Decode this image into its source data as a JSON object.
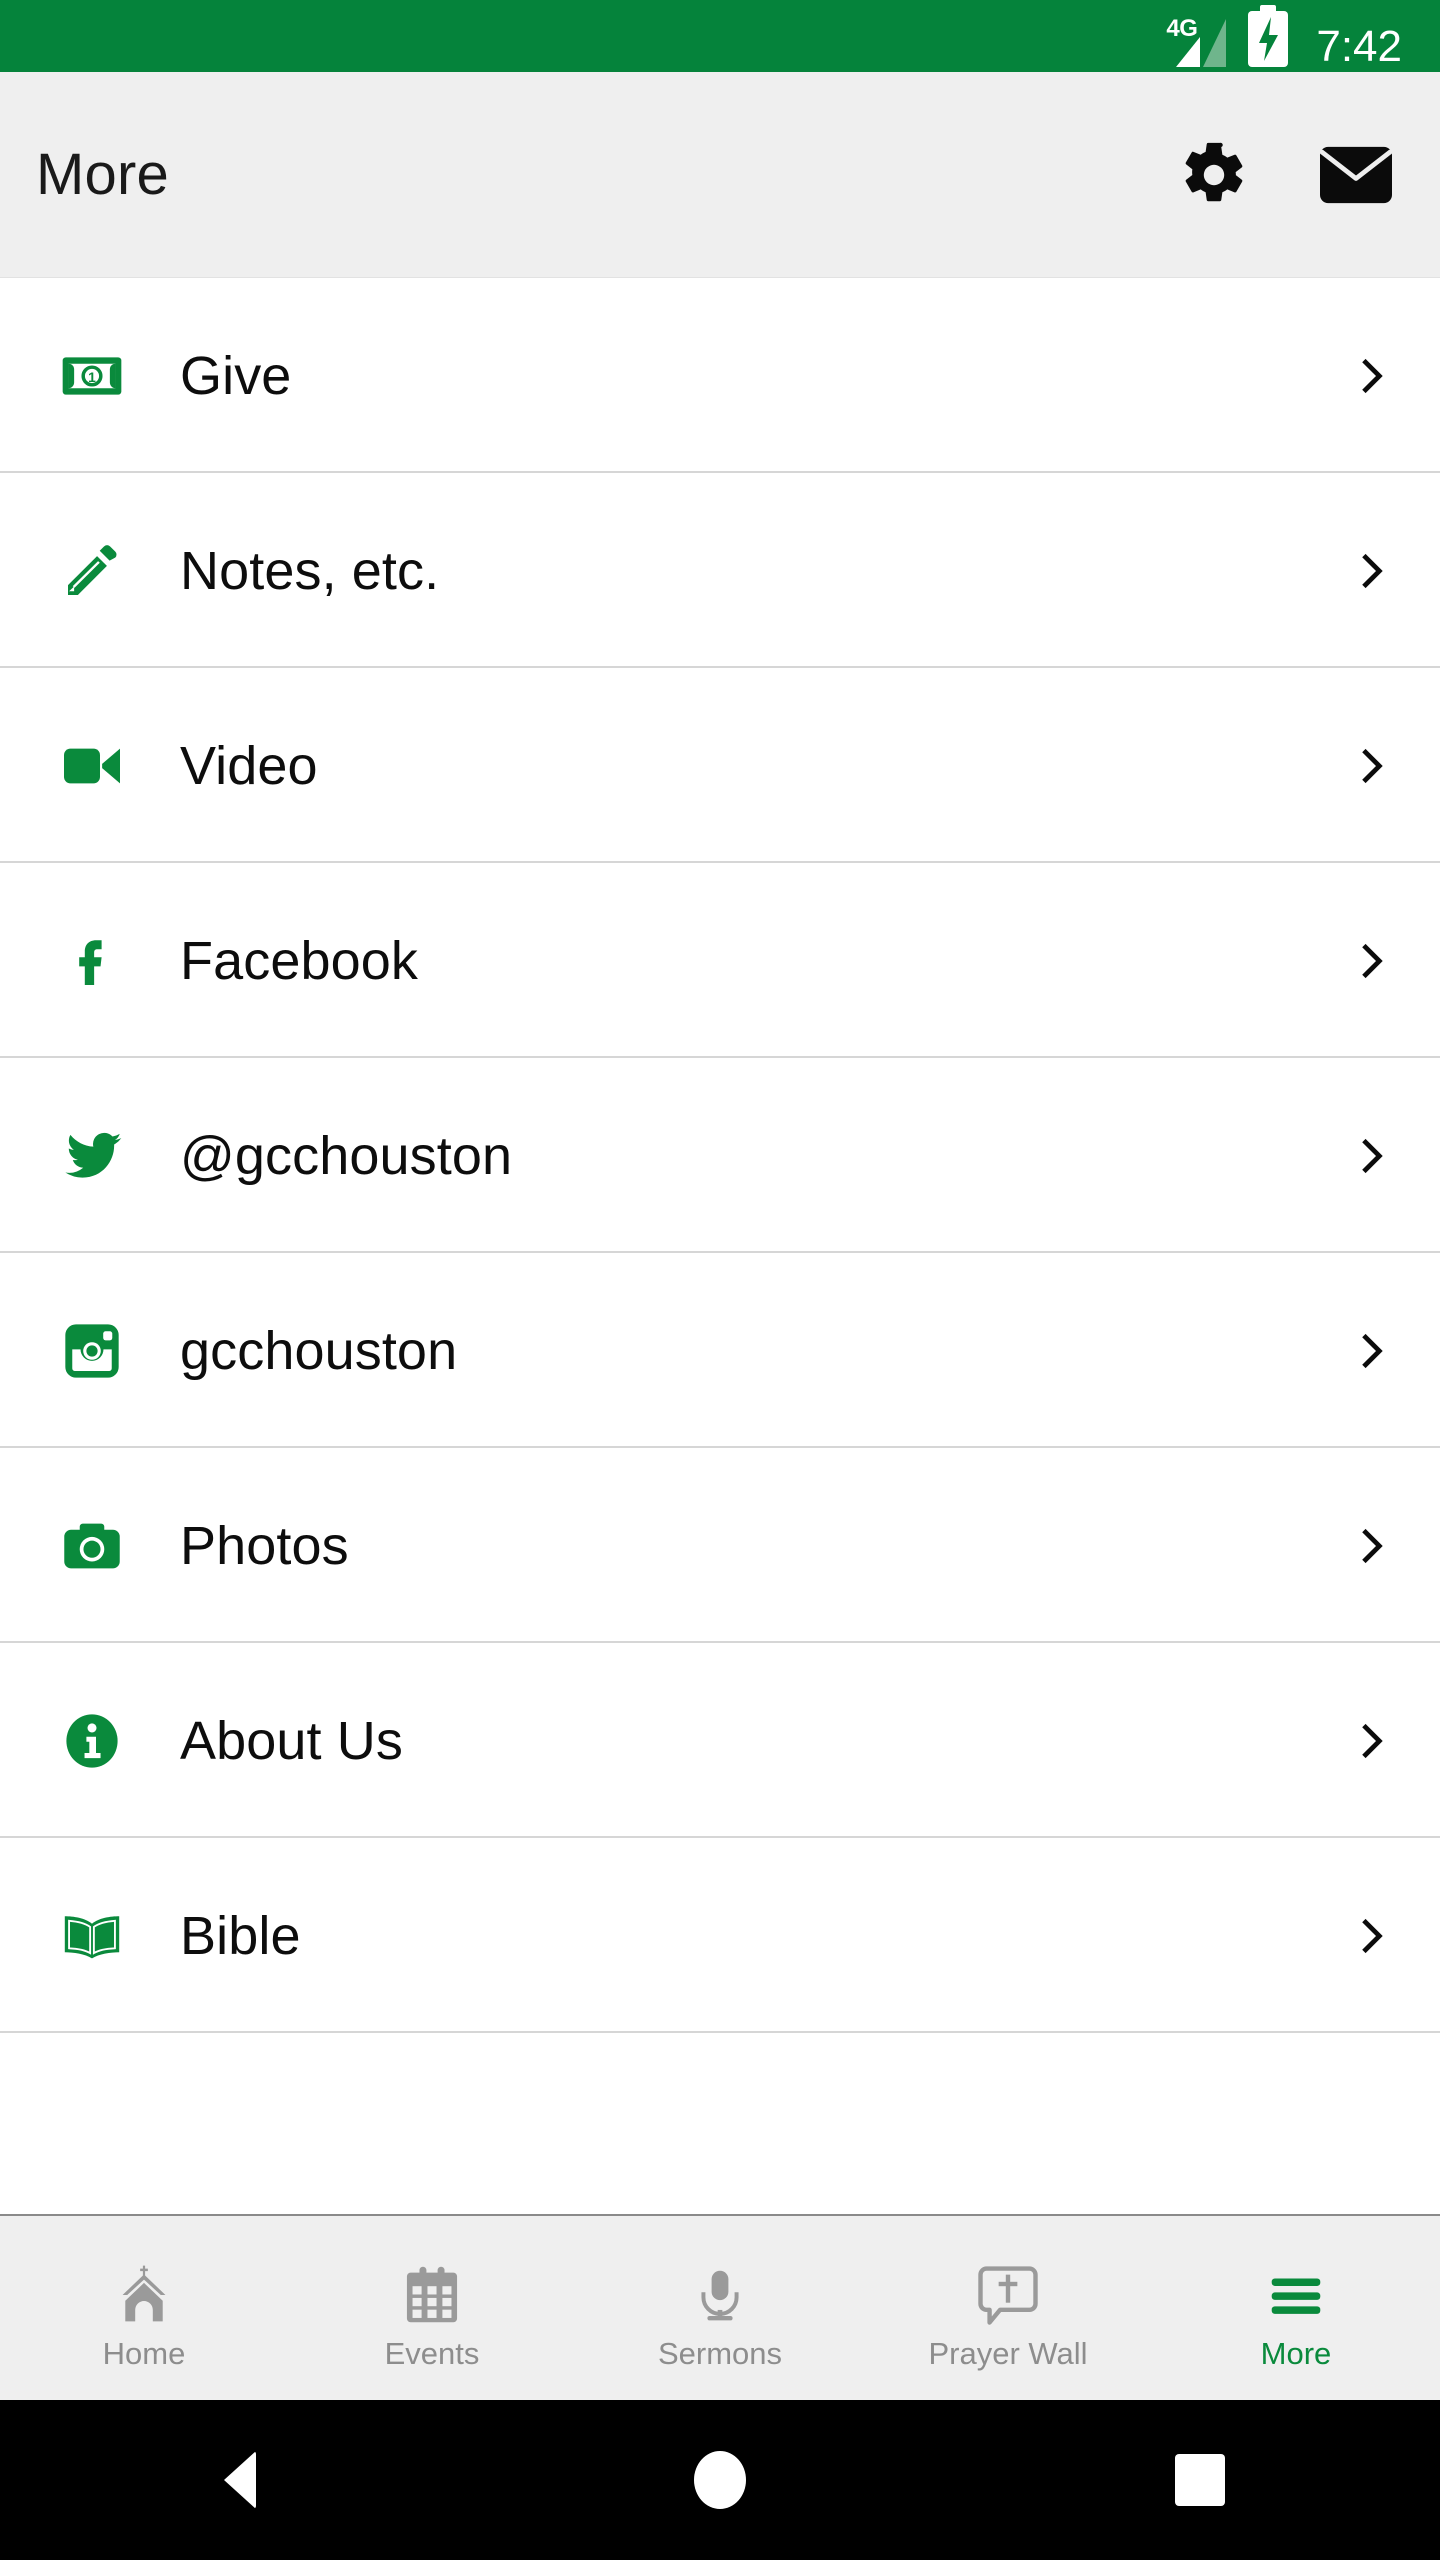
{
  "theme": {
    "brand_green": "#05833b",
    "icon_green": "#0a8a3c",
    "appbar_bg": "#efefef",
    "divider": "#d6d6d6",
    "tab_inactive": "#8d8d8d"
  },
  "status_bar": {
    "network_type": "4G",
    "network_icon": "signal-bars-icon",
    "battery_icon": "battery-charging-icon",
    "time": "7:42"
  },
  "app_bar": {
    "title": "More",
    "actions": [
      {
        "name": "settings-button",
        "icon": "gear-icon"
      },
      {
        "name": "mail-button",
        "icon": "envelope-icon"
      }
    ]
  },
  "list": {
    "items": [
      {
        "label": "Give",
        "icon": "money-bill-icon",
        "chevron": "chevron-right-icon"
      },
      {
        "label": "Notes, etc.",
        "icon": "pencil-icon",
        "chevron": "chevron-right-icon"
      },
      {
        "label": "Video",
        "icon": "video-camera-icon",
        "chevron": "chevron-right-icon"
      },
      {
        "label": "Facebook",
        "icon": "facebook-icon",
        "chevron": "chevron-right-icon"
      },
      {
        "label": "@gcchouston",
        "icon": "twitter-icon",
        "chevron": "chevron-right-icon"
      },
      {
        "label": "gcchouston",
        "icon": "instagram-icon",
        "chevron": "chevron-right-icon"
      },
      {
        "label": "Photos",
        "icon": "camera-icon",
        "chevron": "chevron-right-icon"
      },
      {
        "label": "About Us",
        "icon": "info-circle-icon",
        "chevron": "chevron-right-icon"
      },
      {
        "label": "Bible",
        "icon": "open-book-icon",
        "chevron": "chevron-right-icon"
      }
    ]
  },
  "tab_bar": {
    "tabs": [
      {
        "label": "Home",
        "icon": "church-icon",
        "active": false
      },
      {
        "label": "Events",
        "icon": "calendar-icon",
        "active": false
      },
      {
        "label": "Sermons",
        "icon": "microphone-icon",
        "active": false
      },
      {
        "label": "Prayer Wall",
        "icon": "speech-bubble-cross-icon",
        "active": false
      },
      {
        "label": "More",
        "icon": "hamburger-menu-icon",
        "active": true
      }
    ]
  },
  "android_nav": {
    "buttons": [
      {
        "name": "back-button",
        "icon": "triangle-back-icon"
      },
      {
        "name": "home-button",
        "icon": "circle-home-icon"
      },
      {
        "name": "recents-button",
        "icon": "square-recents-icon"
      }
    ]
  }
}
